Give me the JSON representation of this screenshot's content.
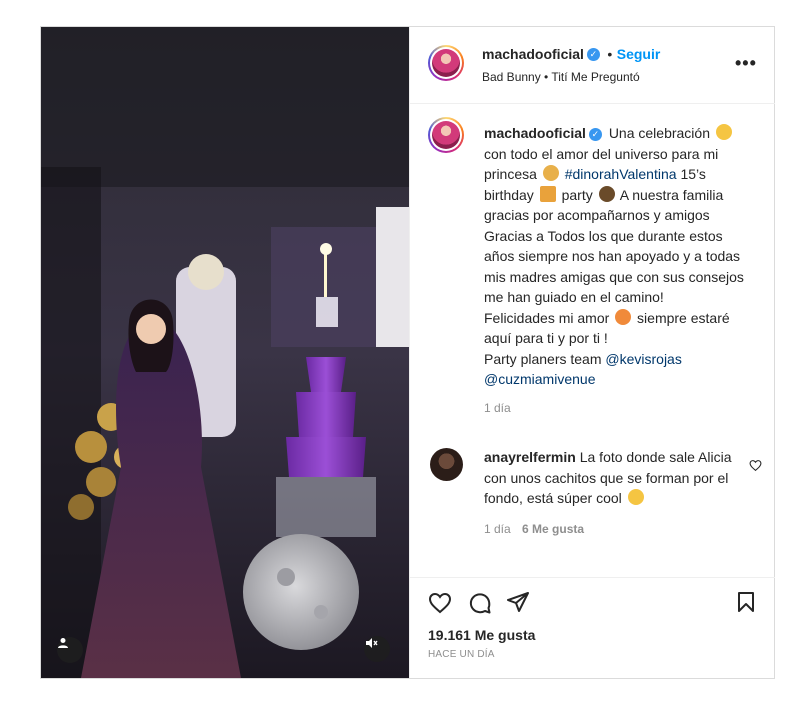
{
  "post": {
    "author": {
      "username": "machadooficial",
      "verified_icon": "verified-badge-icon",
      "separator": "•",
      "follow_label": "Seguir",
      "audio": "Bad Bunny • Tití Me Preguntó"
    },
    "more_label": "•••",
    "caption": {
      "username": "machadooficial",
      "parts": {
        "p1": "Una celebración",
        "p2": "con todo el amor del universo para mi princesa",
        "hashtag": "#dinorahValentina",
        "p3": "15’s birthday",
        "p4": "party",
        "p5": "A nuestra familia gracias por acompañarnos y amigos Gracias a Todos los que durante estos años siempre nos han apoyado y a todas mis madres amigas que con sus consejos me han guiado en el camino!",
        "p6": "Felicidades mi amor",
        "p7": "siempre estaré aquí para ti y por ti !",
        "p8": "Party planers team",
        "mention1": "@kevisrojas",
        "mention2": "@cuzmiamivenue"
      },
      "time": "1 día"
    },
    "comment": {
      "username": "anayrelfermin",
      "text": "La foto donde sale Alicia con unos cachitos que se forman por el fondo, está súper cool",
      "time": "1 día",
      "likes": "6 Me gusta"
    },
    "likes": "19.161 Me gusta",
    "timestamp": "HACE UN DÍA",
    "icons": {
      "like": "heart-icon",
      "comment": "comment-icon",
      "share": "send-icon",
      "save": "bookmark-icon",
      "user": "user-tag-icon",
      "mute": "muted-speaker-icon"
    },
    "colors": {
      "link": "#00376b",
      "follow": "#0095f6",
      "muted_text": "#8e8e8e",
      "verified": "#3897f0"
    }
  }
}
